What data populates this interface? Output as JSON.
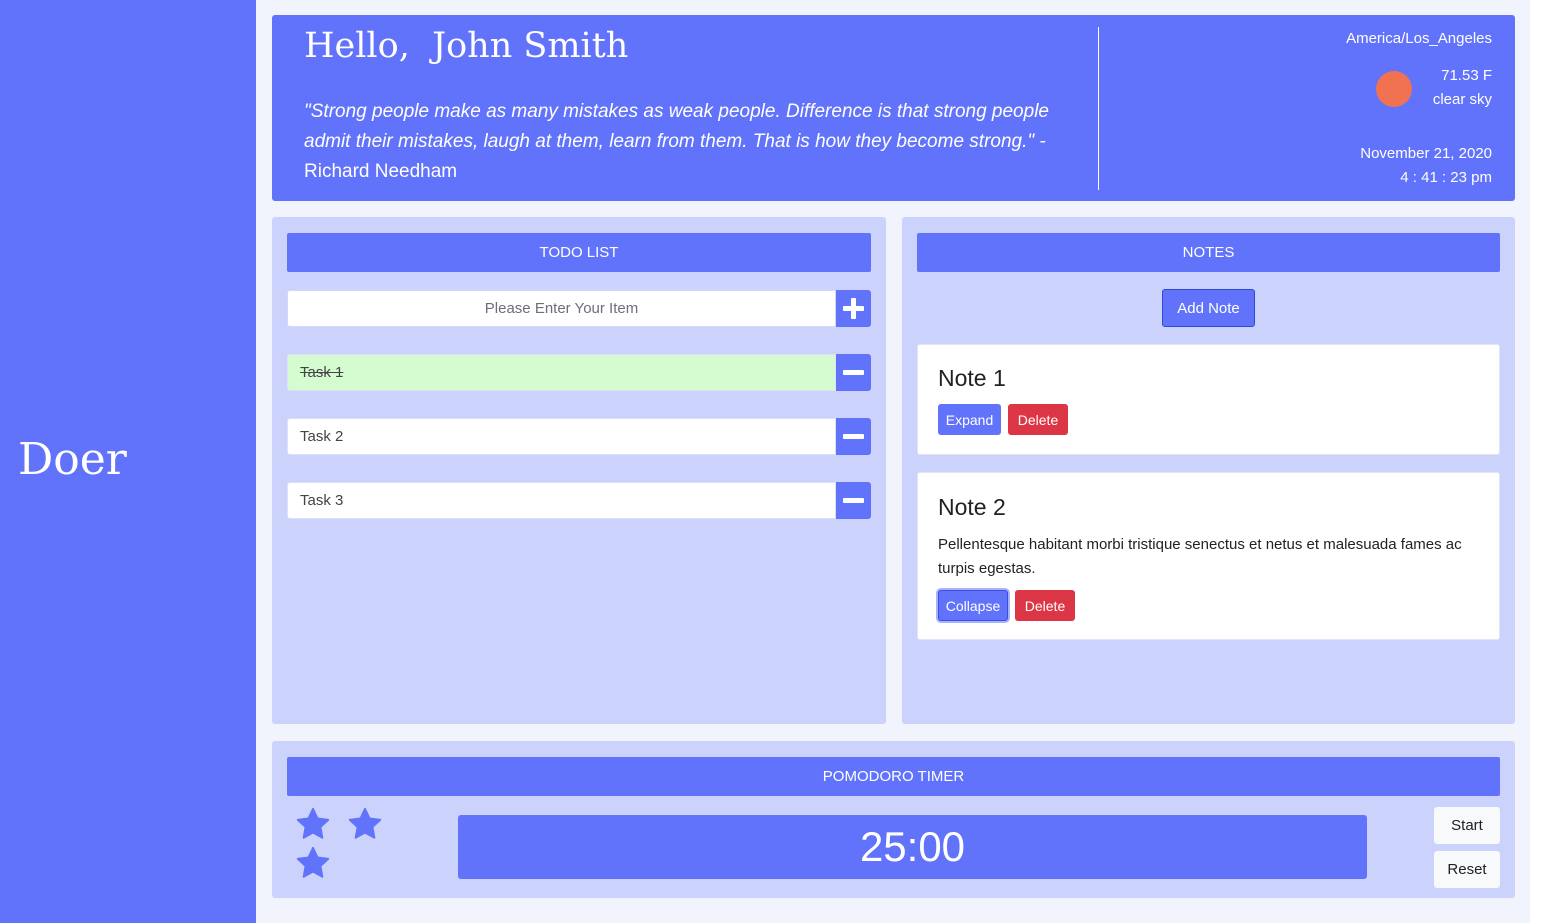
{
  "app": {
    "brand": "Doer"
  },
  "header": {
    "greeting": "Hello,  John Smith",
    "quote": "\"Strong people make as many mistakes as weak people. Difference is that strong people admit their mistakes, laugh at them, learn from them. That is how they become strong.\" -",
    "quote_author": "Richard Needham",
    "timezone": "America/Los_Angeles",
    "temperature": "71.53 F",
    "condition": "clear sky",
    "date": "November 21, 2020",
    "time": "4 : 41 : 23 pm",
    "weather_icon": "sun-icon",
    "sun_color": "#f07250"
  },
  "todo": {
    "title": "TODO LIST",
    "input_placeholder": "Please Enter Your Item",
    "add_icon": "plus-icon",
    "remove_icon": "minus-icon",
    "tasks": [
      {
        "label": "Task 1",
        "done": true
      },
      {
        "label": "Task 2",
        "done": false
      },
      {
        "label": "Task 3",
        "done": false
      }
    ]
  },
  "notes": {
    "title": "NOTES",
    "add_label": "Add Note",
    "items": [
      {
        "title": "Note 1",
        "body": "",
        "toggle_label": "Expand",
        "delete_label": "Delete"
      },
      {
        "title": "Note 2",
        "body": "Pellentesque habitant morbi tristique senectus et netus et malesuada fames ac turpis egestas.",
        "toggle_label": "Collapse",
        "delete_label": "Delete"
      }
    ]
  },
  "pomodoro": {
    "title": "POMODORO TIMER",
    "time": "25:00",
    "stars_count": 3,
    "star_icon": "star-icon",
    "start_label": "Start",
    "reset_label": "Reset"
  },
  "colors": {
    "accent": "#6173fb",
    "panel": "#cbd2fc",
    "done_task": "#d4fcd0",
    "danger": "#dc3545"
  }
}
